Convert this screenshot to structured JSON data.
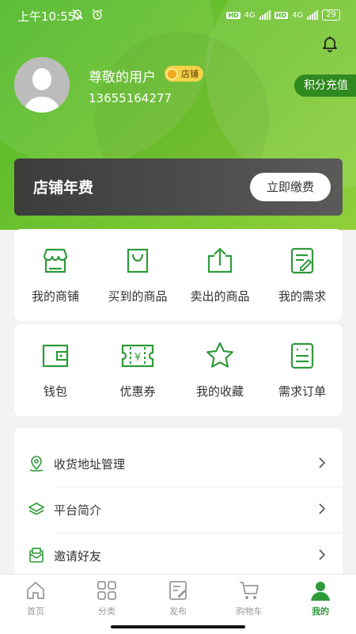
{
  "status": {
    "time": "上午10:55",
    "network1": "4G",
    "network2": "4G",
    "battery": "29"
  },
  "profile": {
    "username": "尊敬的用户",
    "badge": "店铺",
    "phone": "13655164277",
    "points_button": "积分充值"
  },
  "fee": {
    "title": "店铺年费",
    "button": "立即缴费"
  },
  "grid1": [
    {
      "label": "我的商铺",
      "icon": "shop-icon"
    },
    {
      "label": "买到的商品",
      "icon": "shopping-bag-icon"
    },
    {
      "label": "卖出的商品",
      "icon": "upload-icon"
    },
    {
      "label": "我的需求",
      "icon": "edit-document-icon"
    }
  ],
  "grid2": [
    {
      "label": "钱包",
      "icon": "wallet-icon"
    },
    {
      "label": "优惠券",
      "icon": "coupon-icon"
    },
    {
      "label": "我的收藏",
      "icon": "star-icon"
    },
    {
      "label": "需求订单",
      "icon": "order-list-icon"
    }
  ],
  "list": [
    {
      "label": "收货地址管理",
      "icon": "location-icon"
    },
    {
      "label": "平台简介",
      "icon": "layers-icon"
    },
    {
      "label": "邀请好友",
      "icon": "invite-icon"
    }
  ],
  "tabs": [
    {
      "label": "首页",
      "icon": "home-icon"
    },
    {
      "label": "分类",
      "icon": "category-icon"
    },
    {
      "label": "发布",
      "icon": "publish-icon"
    },
    {
      "label": "购物车",
      "icon": "cart-icon"
    },
    {
      "label": "我的",
      "icon": "user-icon"
    }
  ],
  "colors": {
    "brand_green": "#2e9a3a",
    "header_green": "#5dbb2c",
    "badge_yellow": "#f5d24a"
  }
}
